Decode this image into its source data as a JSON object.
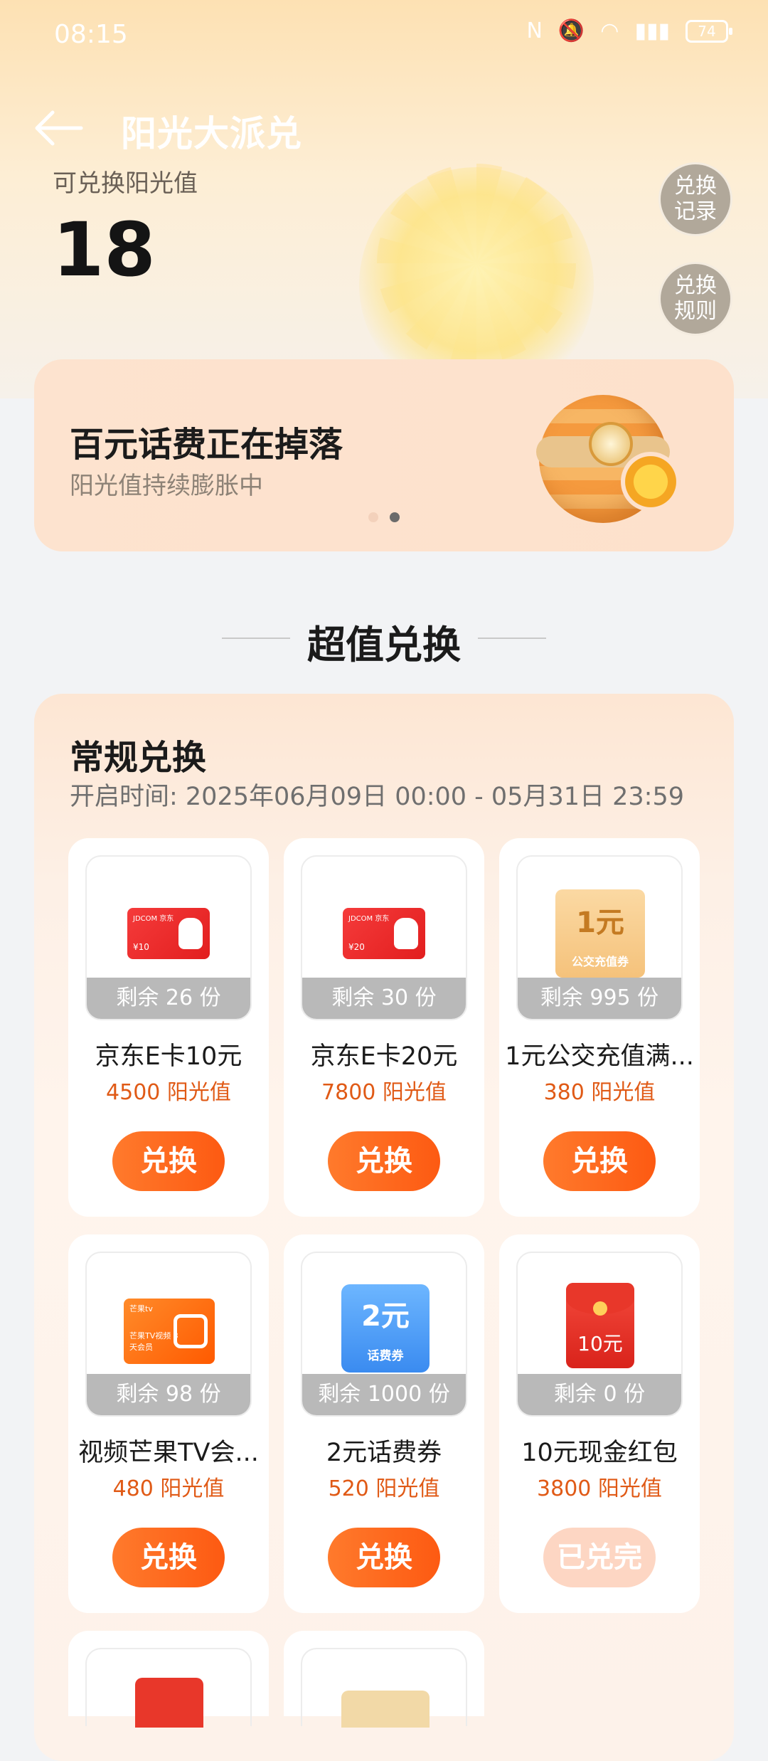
{
  "status_bar": {
    "time": "08:15",
    "battery": "74"
  },
  "header": {
    "title": "阳光大派兑"
  },
  "balance": {
    "label": "可兑换阳光值",
    "value": "18"
  },
  "side_buttons": {
    "records": [
      "兑换",
      "记录"
    ],
    "rules": [
      "兑换",
      "规则"
    ]
  },
  "banner": {
    "title": "百元话费正在掉落",
    "subtitle": "阳光值持续膨胀中",
    "page_count": 2,
    "active_page": 2
  },
  "section": {
    "title": "超值兑换"
  },
  "regular": {
    "title": "常规兑换",
    "time": "开启时间: 2025年06月09日 00:00 - 05月31日 23:59",
    "items": [
      {
        "name": "京东E卡10元",
        "price": "4500 阳光值",
        "stock": "剩余 26 份",
        "button": "兑换",
        "thumb_text": "JDCOM 京东",
        "thumb_value": "¥10",
        "thumb_label": "京东E卡",
        "available": true
      },
      {
        "name": "京东E卡20元",
        "price": "7800 阳光值",
        "stock": "剩余 30 份",
        "button": "兑换",
        "thumb_text": "JDCOM 京东",
        "thumb_value": "¥20",
        "thumb_label": "京东E卡",
        "available": true
      },
      {
        "name": "1元公交充值满...",
        "price": "380 阳光值",
        "stock": "剩余 995 份",
        "button": "兑换",
        "thumb_value": "1元",
        "thumb_label": "公交充值券",
        "available": true
      },
      {
        "name": "视频芒果TV会...",
        "price": "480 阳光值",
        "stock": "剩余 98 份",
        "button": "兑换",
        "thumb_text": "芒果tv",
        "thumb_label": "芒果TV视频 3天会员",
        "available": true
      },
      {
        "name": "2元话费券",
        "price": "520 阳光值",
        "stock": "剩余 1000 份",
        "button": "兑换",
        "thumb_value": "2元",
        "thumb_label": "话费券",
        "available": true
      },
      {
        "name": "10元现金红包",
        "price": "3800 阳光值",
        "stock": "剩余 0 份",
        "button": "已兑完",
        "thumb_value": "10元",
        "available": false
      }
    ]
  },
  "colors": {
    "accent": "#fd5a12",
    "price": "#e05a16",
    "stock_bg": "#b9b9b9"
  }
}
